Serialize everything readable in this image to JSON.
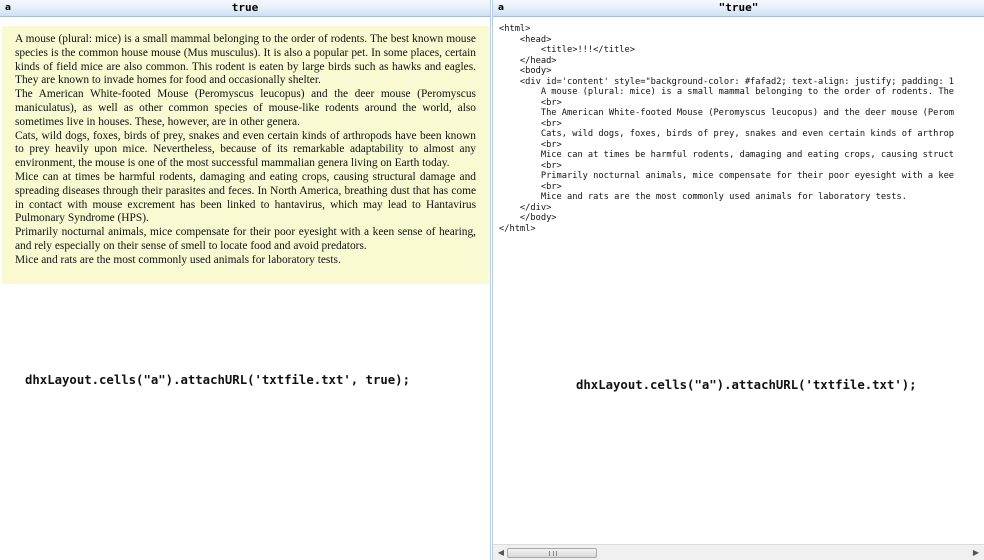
{
  "left_cell": {
    "letter": "a",
    "title": "true",
    "paragraphs": [
      "A mouse (plural: mice) is a small mammal belonging to the order of rodents. The best known mouse species is the common house mouse (Mus musculus). It is also a popular pet. In some places, certain kinds of field mice are also common. This rodent is eaten by large birds such as hawks and eagles. They are known to invade homes for food and occasionally shelter.",
      "The American White-footed Mouse (Peromyscus leucopus) and the deer mouse (Peromyscus maniculatus), as well as other common species of mouse-like rodents around the world, also sometimes live in houses. These, however, are in other genera.",
      "Cats, wild dogs, foxes, birds of prey, snakes and even certain kinds of arthropods have been known to prey heavily upon mice. Nevertheless, because of its remarkable adaptability to almost any environment, the mouse is one of the most successful mammalian genera living on Earth today.",
      "Mice can at times be harmful rodents, damaging and eating crops, causing structural damage and spreading diseases through their parasites and feces. In North America, breathing dust that has come in contact with mouse excrement has been linked to hantavirus, which may lead to Hantavirus Pulmonary Syndrome (HPS).",
      "Primarily nocturnal animals, mice compensate for their poor eyesight with a keen sense of hearing, and rely especially on their sense of smell to locate food and avoid predators.",
      "Mice and rats are the most commonly used animals for laboratory tests."
    ],
    "caption": "dhxLayout.cells(\"a\").attachURL('txtfile.txt', true);",
    "background": "#fafad2"
  },
  "right_cell": {
    "letter": "a",
    "title": "\"true\"",
    "code_lines": [
      "<html>",
      "    <head>",
      "        <title>!!!</title>",
      "    </head>",
      "    <body>",
      "    <div id='content' style=\"background-color: #fafad2; text-align: justify; padding: 1",
      "        A mouse (plural: mice) is a small mammal belonging to the order of rodents. The",
      "        <br>",
      "        The American White-footed Mouse (Peromyscus leucopus) and the deer mouse (Perom",
      "        <br>",
      "        Cats, wild dogs, foxes, birds of prey, snakes and even certain kinds of arthrop",
      "        <br>",
      "        Mice can at times be harmful rodents, damaging and eating crops, causing struct",
      "        <br>",
      "        Primarily nocturnal animals, mice compensate for their poor eyesight with a kee",
      "        <br>",
      "        Mice and rats are the most commonly used animals for laboratory tests.",
      "    </div>",
      "    </body>",
      "</html>"
    ],
    "caption": "dhxLayout.cells(\"a\").attachURL('txtfile.txt');",
    "scroll_left_icon": "scroll-left-arrow",
    "scroll_right_icon": "scroll-right-arrow"
  }
}
